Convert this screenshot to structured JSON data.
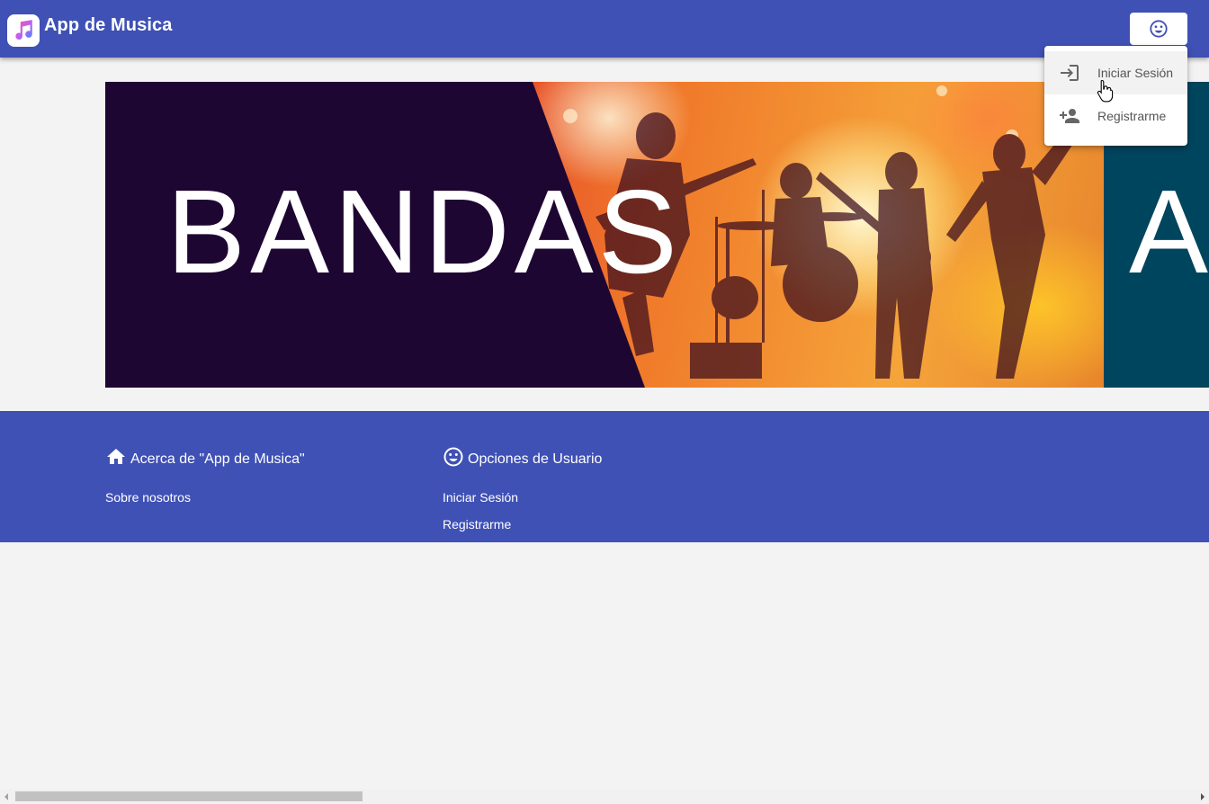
{
  "toolbar": {
    "app_title": "App de Musica",
    "logo_icon": "music-note-icon",
    "user_button_icon": "smiley-face-icon"
  },
  "hero": {
    "title": "BANDAS",
    "next_slide_letter": "A"
  },
  "footer": {
    "about": {
      "icon": "home-icon",
      "heading": "Acerca de \"App de Musica\"",
      "links": [
        "Sobre nosotros"
      ]
    },
    "user_options": {
      "icon": "smiley-face-icon",
      "heading": "Opciones de Usuario",
      "links": [
        "Iniciar Sesión",
        "Registrarme"
      ]
    }
  },
  "user_menu": {
    "items": [
      {
        "label": "Iniciar Sesión",
        "icon": "login-icon"
      },
      {
        "label": "Registrarme",
        "icon": "person-add-icon"
      }
    ]
  },
  "colors": {
    "primary": "#3f51b5",
    "hero_dark": "#1e0633",
    "hero_teal": "#00455e",
    "background": "#f3f3f3"
  }
}
